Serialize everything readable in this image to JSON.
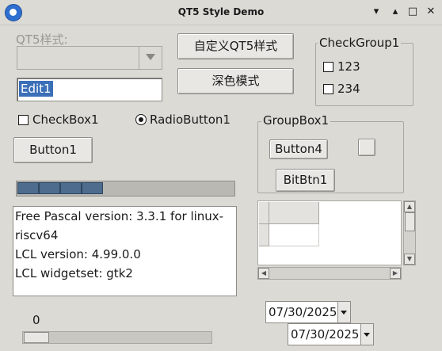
{
  "window": {
    "title": "QT5 Style Demo",
    "minimize": "▾",
    "restore": "▴",
    "maximize": "□",
    "close": "✕"
  },
  "style_label": "QT5样式:",
  "style_combo_value": "",
  "edit1": "Edit1",
  "custom_style_button": "自定义QT5样式",
  "dark_mode_button": "深色模式",
  "checkgroup": {
    "caption": "CheckGroup1",
    "items": [
      "123",
      "234"
    ]
  },
  "checkbox1": "CheckBox1",
  "radiobutton1": "RadioButton1",
  "button1": "Button1",
  "groupbox": {
    "caption": "GroupBox1",
    "button4": "Button4",
    "bitbtn1": "BitBtn1"
  },
  "progress": {
    "value": 0.4
  },
  "memo": {
    "lines": [
      "Free Pascal version: 3.3.1 for linux-",
      "riscv64",
      "LCL version: 4.99.0.0",
      "LCL widgetset: gtk2"
    ]
  },
  "trackbar": {
    "value": "0"
  },
  "date1": "07/30/2025",
  "date2": "07/30/2025",
  "icons": {
    "app": "app-logo-icon",
    "combo_arrow": "chevron-down-icon"
  }
}
